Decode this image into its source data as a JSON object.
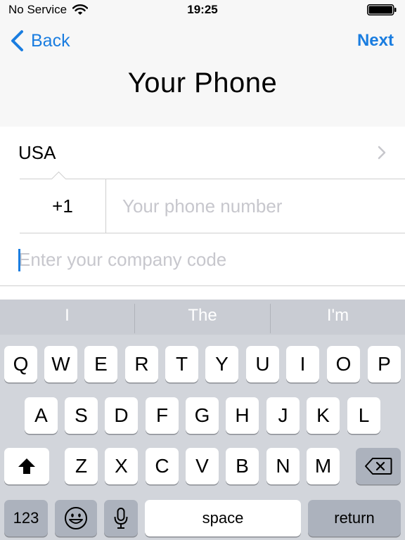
{
  "status_bar": {
    "carrier": "No Service",
    "time": "19:25"
  },
  "nav": {
    "back_label": "Back",
    "next_label": "Next",
    "title": "Your Phone"
  },
  "form": {
    "country": "USA",
    "country_code": "+1",
    "phone_placeholder": "Your phone number",
    "company_placeholder": "Enter your company code"
  },
  "keyboard": {
    "suggestions": [
      "I",
      "The",
      "I'm"
    ],
    "row1": [
      "Q",
      "W",
      "E",
      "R",
      "T",
      "Y",
      "U",
      "I",
      "O",
      "P"
    ],
    "row2": [
      "A",
      "S",
      "D",
      "F",
      "G",
      "H",
      "J",
      "K",
      "L"
    ],
    "row3": [
      "Z",
      "X",
      "C",
      "V",
      "B",
      "N",
      "M"
    ],
    "numbers_label": "123",
    "space_label": "space",
    "return_label": "return"
  },
  "icons": {
    "wifi": "wifi-icon",
    "battery": "battery-icon",
    "back": "chevron-left-icon",
    "disclosure": "chevron-right-icon",
    "shift": "shift-icon",
    "delete": "delete-icon",
    "emoji": "emoji-icon",
    "mic": "microphone-icon"
  },
  "colors": {
    "accent": "#1a7de0",
    "keyboard_bg": "#d2d5db",
    "placeholder": "#c7c7cd"
  }
}
